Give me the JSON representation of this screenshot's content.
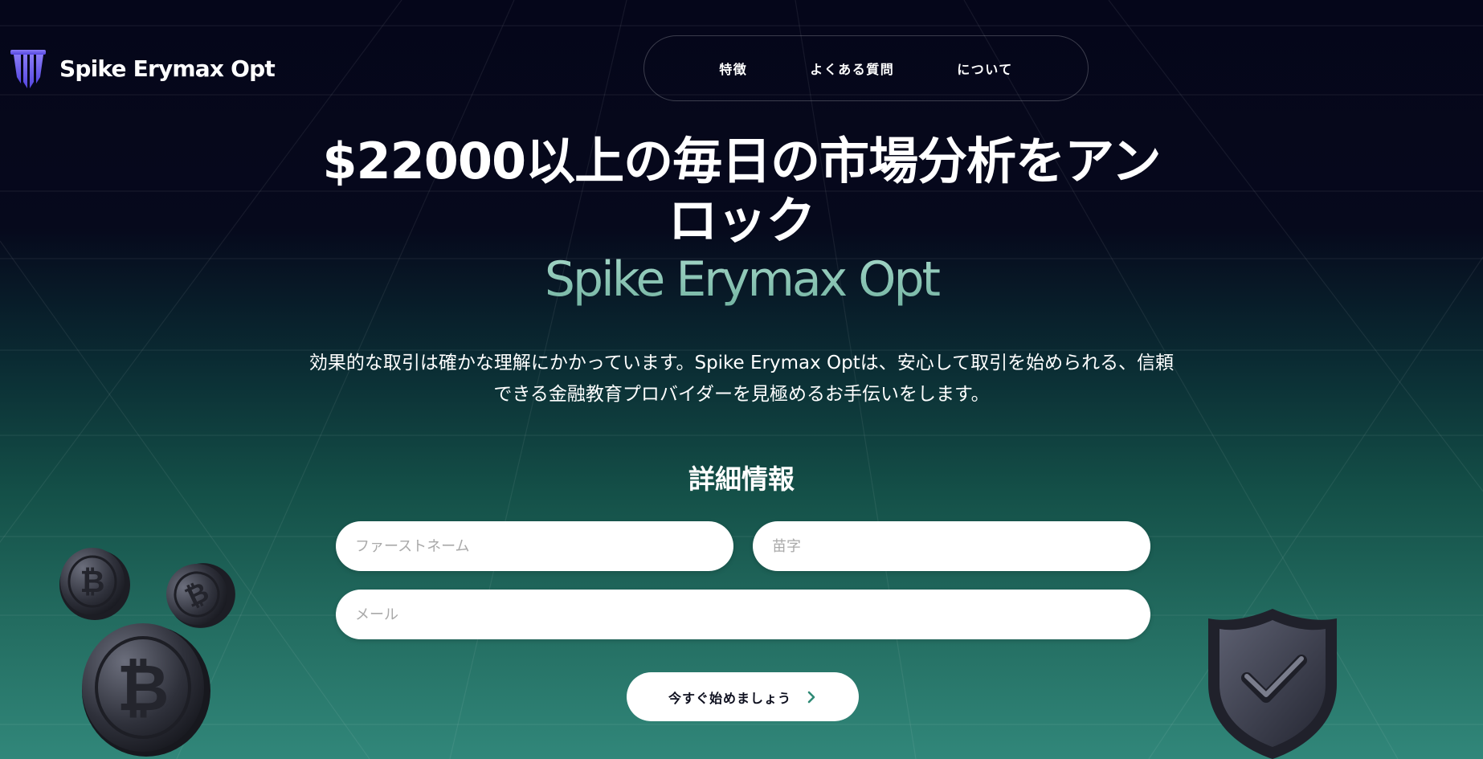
{
  "header": {
    "brand_name": "Spike Erymax Opt",
    "nav": [
      {
        "label": "特徴"
      },
      {
        "label": "よくある質問"
      },
      {
        "label": "について"
      }
    ]
  },
  "hero": {
    "headline": "$22000以上の毎日の市場分析をアンロック",
    "brand_subtitle": "Spike Erymax Opt",
    "description_line1": "効果的な取引は確かな理解にかかっています。Spike Erymax Optは、安心して取引を始められる、信頼",
    "description_line2": "できる金融教育プロバイダーを見極めるお手伝いをします。"
  },
  "form": {
    "title": "詳細情報",
    "first_name_placeholder": "ファーストネーム",
    "last_name_placeholder": "苗字",
    "email_placeholder": "メール",
    "submit_label": "今すぐ始めましょう"
  },
  "icons": {
    "logo": "brand-logo-icon",
    "submit_arrow": "chevron-right-icon",
    "coins": "bitcoin-coins-icon",
    "shield": "shield-check-icon"
  },
  "colors": {
    "logo_accent": "#6b5ff0",
    "brand_gradient_top": "#a6d8c9",
    "brand_gradient_bottom": "#72b3a1",
    "background_top": "#05061a",
    "background_bottom": "#31877a",
    "cta_arrow": "#2f8a76"
  }
}
